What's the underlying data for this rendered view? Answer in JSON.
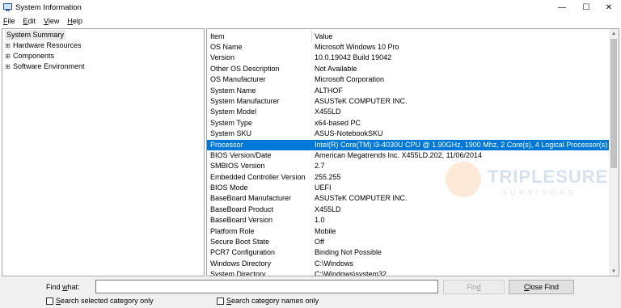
{
  "window": {
    "title": "System Information",
    "minimize_glyph": "—",
    "maximize_glyph": "☐",
    "close_glyph": "✕"
  },
  "menu": [
    {
      "accel": "F",
      "rest": "ile"
    },
    {
      "accel": "E",
      "rest": "dit"
    },
    {
      "accel": "V",
      "rest": "iew"
    },
    {
      "accel": "H",
      "rest": "elp"
    }
  ],
  "tree": {
    "root": "System Summary",
    "children": [
      {
        "expander": "⊞",
        "label": "Hardware Resources"
      },
      {
        "expander": "⊞",
        "label": "Components"
      },
      {
        "expander": "⊞",
        "label": "Software Environment"
      }
    ]
  },
  "table": {
    "headers": {
      "item": "Item",
      "value": "Value"
    },
    "selected_index": 10,
    "rows": [
      {
        "item": "OS Name",
        "value": "Microsoft Windows 10 Pro"
      },
      {
        "item": "Version",
        "value": "10.0.19042 Build 19042"
      },
      {
        "item": "Other OS Description",
        "value": "Not Available"
      },
      {
        "item": "OS Manufacturer",
        "value": "Microsoft Corporation"
      },
      {
        "item": "System Name",
        "value": "ALTHOF"
      },
      {
        "item": "System Manufacturer",
        "value": "ASUSTeK COMPUTER INC."
      },
      {
        "item": "System Model",
        "value": "X455LD"
      },
      {
        "item": "System Type",
        "value": "x64-based PC"
      },
      {
        "item": "System SKU",
        "value": "ASUS-NotebookSKU"
      },
      {
        "item": "Processor",
        "value": "Intel(R) Core(TM) i3-4030U CPU @ 1.90GHz, 1900 Mhz, 2 Core(s), 4 Logical Processor(s)"
      },
      {
        "item": "BIOS Version/Date",
        "value": "American Megatrends Inc. X455LD.202, 11/06/2014"
      },
      {
        "item": "SMBIOS Version",
        "value": "2.7"
      },
      {
        "item": "Embedded Controller Version",
        "value": "255.255"
      },
      {
        "item": "BIOS Mode",
        "value": "UEFI"
      },
      {
        "item": "BaseBoard Manufacturer",
        "value": "ASUSTeK COMPUTER INC."
      },
      {
        "item": "BaseBoard Product",
        "value": "X455LD"
      },
      {
        "item": "BaseBoard Version",
        "value": "1.0"
      },
      {
        "item": "Platform Role",
        "value": "Mobile"
      },
      {
        "item": "Secure Boot State",
        "value": "Off"
      },
      {
        "item": "PCR7 Configuration",
        "value": "Binding Not Possible"
      },
      {
        "item": "Windows Directory",
        "value": "C:\\Windows"
      },
      {
        "item": "System Directory",
        "value": "C:\\Windows\\system32"
      }
    ]
  },
  "watermark": {
    "text": "TRIPLESURE",
    "sub": "SURVIVORS",
    "accent": "#f28c28",
    "brand": "#1f5fa8"
  },
  "find": {
    "label_accel_pre": "Find ",
    "label_accel": "w",
    "label_accel_post": "hat:",
    "input_value": "",
    "find_button": {
      "pre": "Fin",
      "accel": "d",
      "post": ""
    },
    "close_button": {
      "accel": "C",
      "post": "lose Find"
    },
    "check1": {
      "accel": "S",
      "post": "earch selected category only",
      "checked": false
    },
    "check2": {
      "accel": "S",
      "post": "earch category names only",
      "checked": false
    }
  },
  "colors": {
    "selection": "#0078d7",
    "selection_text": "#ffffff"
  }
}
